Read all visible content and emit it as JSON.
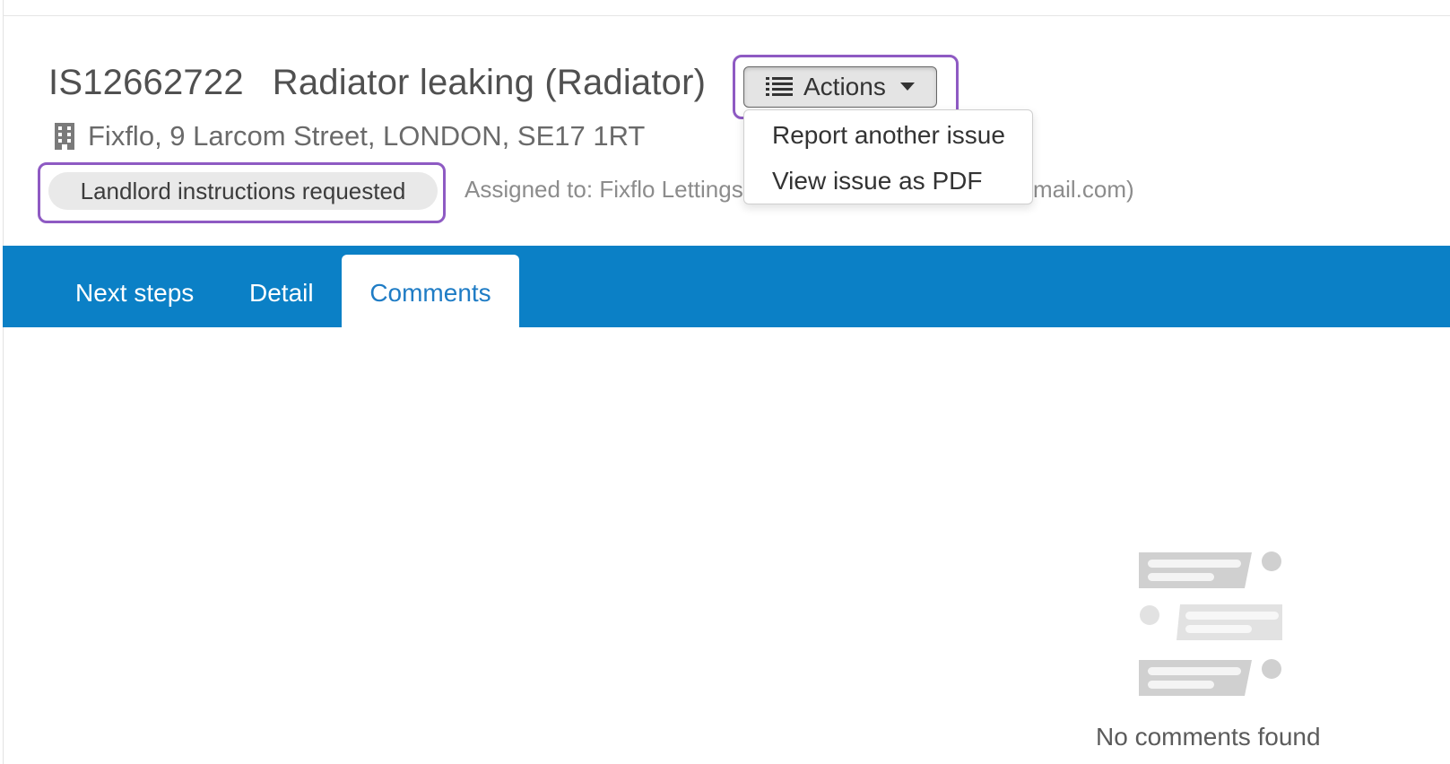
{
  "issue": {
    "reference": "IS12662722",
    "title": "Radiator leaking (Radiator)",
    "address": "Fixflo, 9 Larcom Street, LONDON, SE17 1RT",
    "status": "Landlord instructions requested",
    "assigned_prefix": "Assigned to: Fixflo Lettings",
    "assigned_suffix": "mail.com)"
  },
  "actions": {
    "label": "Actions",
    "menu_items": [
      "Report another issue",
      "View issue as PDF"
    ]
  },
  "tabs": [
    {
      "label": "Next steps",
      "active": false
    },
    {
      "label": "Detail",
      "active": false
    },
    {
      "label": "Comments",
      "active": true
    }
  ],
  "comments": {
    "empty_message": "No comments found"
  },
  "colors": {
    "tab_bar": "#0b80c6",
    "active_tab_text": "#1f7cc5",
    "highlight_border": "#8e5ac3"
  },
  "icons": [
    "building-icon",
    "list-icon",
    "caret-down-icon",
    "no-comments-illustration-icon"
  ]
}
